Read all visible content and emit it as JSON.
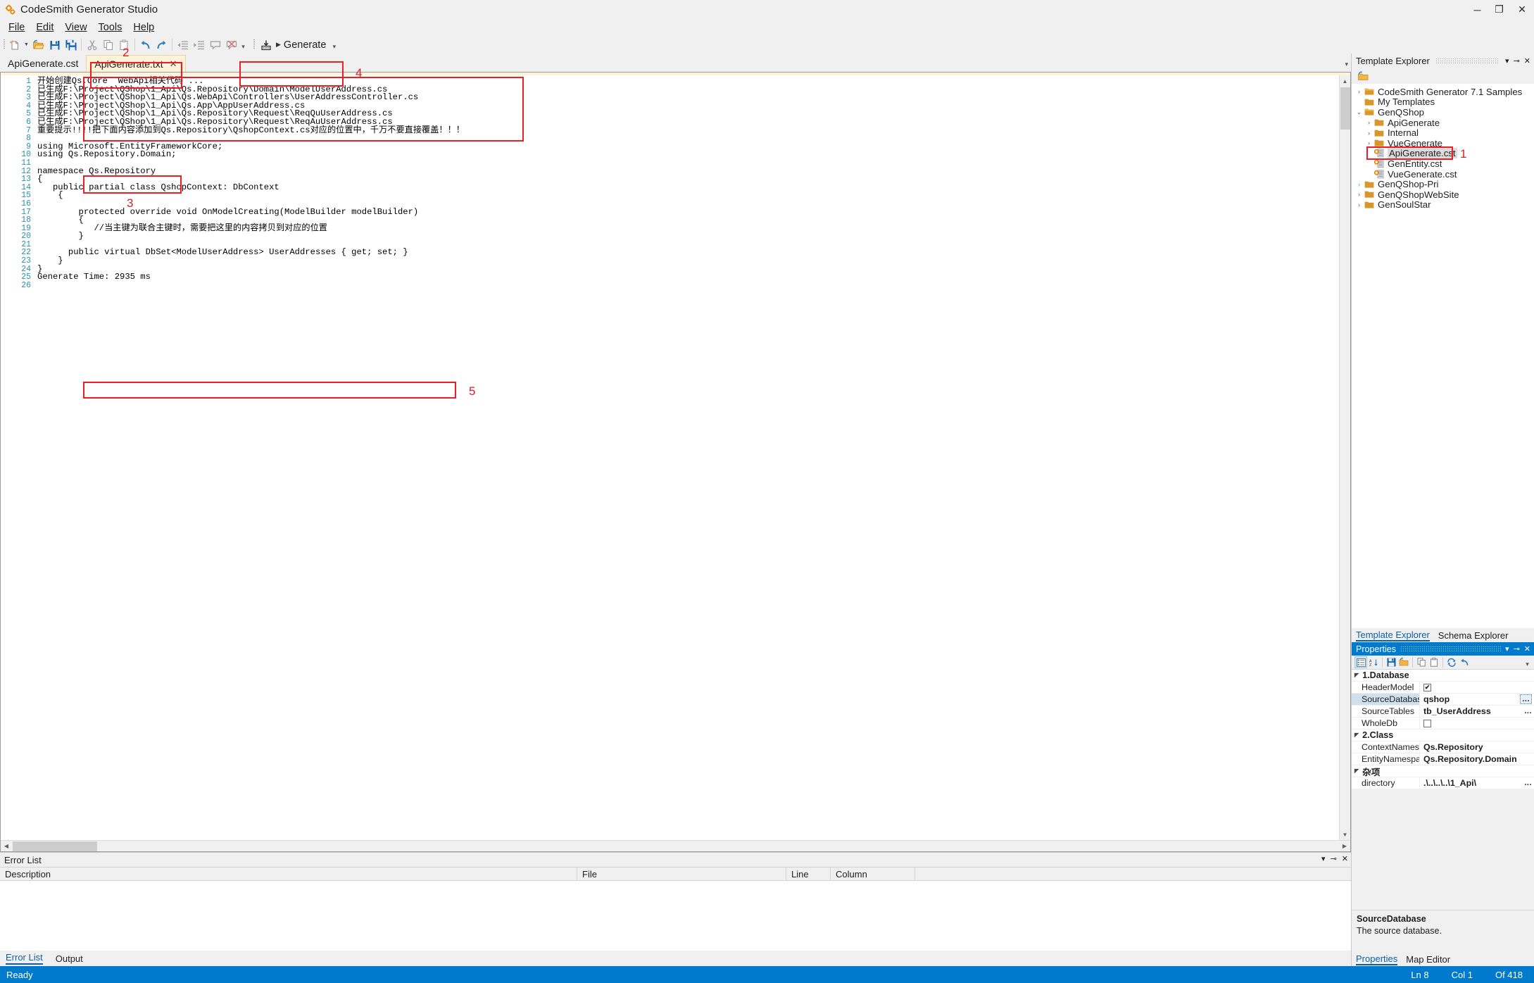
{
  "window": {
    "title": "CodeSmith Generator Studio",
    "app_icon": "gears-icon",
    "minimize": "─",
    "maximize": "❐",
    "close": "✕"
  },
  "menu": {
    "items": [
      {
        "label": "File",
        "accel": "F"
      },
      {
        "label": "Edit",
        "accel": "E"
      },
      {
        "label": "View",
        "accel": "V"
      },
      {
        "label": "Tools",
        "accel": "T"
      },
      {
        "label": "Help",
        "accel": "H"
      }
    ]
  },
  "toolbar": {
    "buttons": [
      {
        "name": "new-icon"
      },
      {
        "name": "open-folder-icon"
      },
      {
        "name": "save-icon"
      },
      {
        "name": "save-all-icon"
      },
      {
        "name": "cut-icon"
      },
      {
        "name": "copy-icon"
      },
      {
        "name": "paste-icon"
      },
      {
        "name": "undo-icon"
      },
      {
        "name": "redo-icon"
      },
      {
        "name": "outdent-icon"
      },
      {
        "name": "indent-icon"
      },
      {
        "name": "comment-icon"
      },
      {
        "name": "uncomment-icon"
      }
    ],
    "generate_label": "Generate",
    "generate_icon": "generate-icon"
  },
  "doc_tabs": [
    {
      "label": "ApiGenerate.cst",
      "active": false,
      "closable": false
    },
    {
      "label": "ApiGenerate.txt",
      "active": true,
      "closable": true
    }
  ],
  "editor": {
    "lines": [
      {
        "n": "1",
        "text": "开始创建Qs.Core  WebApi相关代码 ..."
      },
      {
        "n": "2",
        "text": "已生成F:\\Project\\QShop\\1_Api\\Qs.Repository\\Domain\\ModelUserAddress.cs"
      },
      {
        "n": "3",
        "text": "已生成F:\\Project\\QShop\\1_Api\\Qs.WebApi\\Controllers\\UserAddressController.cs"
      },
      {
        "n": "4",
        "text": "已生成F:\\Project\\QShop\\1_Api\\Qs.App\\AppUserAddress.cs"
      },
      {
        "n": "5",
        "text": "已生成F:\\Project\\QShop\\1_Api\\Qs.Repository\\Request\\ReqQuUserAddress.cs"
      },
      {
        "n": "6",
        "text": "已生成F:\\Project\\QShop\\1_Api\\Qs.Repository\\Request\\ReqAuUserAddress.cs"
      },
      {
        "n": "7",
        "text": "重要提示!!!!把下面内容添加到Qs.Repository\\QshopContext.cs对应的位置中，千万不要直接覆盖！！！"
      },
      {
        "n": "8",
        "text": ""
      },
      {
        "n": "9",
        "text": "using Microsoft.EntityFrameworkCore;"
      },
      {
        "n": "10",
        "text": "using Qs.Repository.Domain;"
      },
      {
        "n": "11",
        "text": ""
      },
      {
        "n": "12",
        "text": "namespace Qs.Repository"
      },
      {
        "n": "13",
        "text": "{"
      },
      {
        "n": "14",
        "text": "   public partial class QshopContext: DbContext"
      },
      {
        "n": "15",
        "text": "    {"
      },
      {
        "n": "16",
        "text": ""
      },
      {
        "n": "17",
        "text": "        protected override void OnModelCreating(ModelBuilder modelBuilder)"
      },
      {
        "n": "18",
        "text": "        {"
      },
      {
        "n": "19",
        "text": "           //当主键为联合主键时，需要把这里的内容拷贝到对应的位置"
      },
      {
        "n": "20",
        "text": "        }"
      },
      {
        "n": "21",
        "text": ""
      },
      {
        "n": "22",
        "text": "      public virtual DbSet<ModelUserAddress> UserAddresses { get; set; }"
      },
      {
        "n": "23",
        "text": "    }"
      },
      {
        "n": "24",
        "text": "}"
      },
      {
        "n": "25",
        "text": "Generate Time: 2935 ms"
      },
      {
        "n": "26",
        "text": ""
      }
    ]
  },
  "annotations": [
    {
      "id": "1",
      "label": "1"
    },
    {
      "id": "2",
      "label": "2"
    },
    {
      "id": "3",
      "label": "3"
    },
    {
      "id": "4",
      "label": "4"
    },
    {
      "id": "5",
      "label": "5"
    }
  ],
  "template_explorer": {
    "title": "Template Explorer",
    "refresh_icon": "refresh-folder-icon",
    "dropdown_icon": "chevron-down-icon",
    "pin_icon": "pin-icon",
    "close_icon": "close-icon",
    "tree": [
      {
        "label": "CodeSmith Generator 7.1 Samples",
        "depth": 0,
        "chev": "collapsed",
        "icon": "folder-special-icon"
      },
      {
        "label": "My Templates",
        "depth": 0,
        "chev": "none",
        "icon": "folder-icon"
      },
      {
        "label": "GenQShop",
        "depth": 0,
        "chev": "expanded",
        "icon": "folder-special-icon"
      },
      {
        "label": "ApiGenerate",
        "depth": 1,
        "chev": "collapsed",
        "icon": "folder-icon"
      },
      {
        "label": "Internal",
        "depth": 1,
        "chev": "collapsed",
        "icon": "folder-icon"
      },
      {
        "label": "VueGenerate",
        "depth": 1,
        "chev": "collapsed",
        "icon": "folder-icon"
      },
      {
        "label": "ApiGenerate.cst",
        "depth": 1,
        "chev": "none",
        "icon": "template-file-icon",
        "selected": true
      },
      {
        "label": "GenEntity.cst",
        "depth": 1,
        "chev": "none",
        "icon": "template-file-icon"
      },
      {
        "label": "VueGenerate.cst",
        "depth": 1,
        "chev": "none",
        "icon": "template-file-icon"
      },
      {
        "label": "GenQShop-Pri",
        "depth": 0,
        "chev": "collapsed-blue",
        "icon": "folder-icon"
      },
      {
        "label": "GenQShopWebSite",
        "depth": 0,
        "chev": "collapsed",
        "icon": "folder-icon"
      },
      {
        "label": "GenSoulStar",
        "depth": 0,
        "chev": "collapsed",
        "icon": "folder-icon"
      }
    ],
    "footer_tabs": [
      {
        "label": "Template Explorer",
        "active": true
      },
      {
        "label": "Schema Explorer",
        "active": false
      }
    ]
  },
  "properties": {
    "title": "Properties",
    "toolbar_icons": [
      "categorized-icon",
      "alphabetical-icon",
      "save-icon",
      "open-icon",
      "copy-icon",
      "paste-icon",
      "refresh-icon",
      "reset-icon"
    ],
    "groups": [
      {
        "name": "1.Database",
        "rows": [
          {
            "name": "HeaderModel",
            "value": "",
            "type": "checkbox",
            "checked": true
          },
          {
            "name": "SourceDatabase",
            "value": "qshop",
            "type": "text",
            "ellipsis": "boxed",
            "selected": true
          },
          {
            "name": "SourceTables",
            "value": "tb_UserAddress",
            "type": "text",
            "ellipsis": "plain"
          },
          {
            "name": "WholeDb",
            "value": "",
            "type": "checkbox",
            "checked": false
          }
        ]
      },
      {
        "name": "2.Class",
        "rows": [
          {
            "name": "ContextNamespace",
            "value": "Qs.Repository",
            "type": "text"
          },
          {
            "name": "EntityNamespace",
            "value": "Qs.Repository.Domain",
            "type": "text"
          }
        ]
      },
      {
        "name": "杂项",
        "rows": [
          {
            "name": "directory",
            "value": ".\\..\\..\\..\\1_Api\\",
            "type": "text",
            "ellipsis": "plain"
          }
        ]
      }
    ],
    "description": {
      "title": "SourceDatabase",
      "text": "The source database."
    },
    "footer_tabs": [
      {
        "label": "Properties",
        "active": true
      },
      {
        "label": "Map Editor",
        "active": false
      }
    ]
  },
  "error_list": {
    "title": "Error List",
    "columns": [
      "Description",
      "File",
      "Line",
      "Column"
    ],
    "rows": [],
    "tabs": [
      {
        "label": "Error List",
        "active": true
      },
      {
        "label": "Output",
        "active": false
      }
    ]
  },
  "statusbar": {
    "status": "Ready",
    "line": "Ln 8",
    "col": "Col 1",
    "of": "Of 418"
  }
}
